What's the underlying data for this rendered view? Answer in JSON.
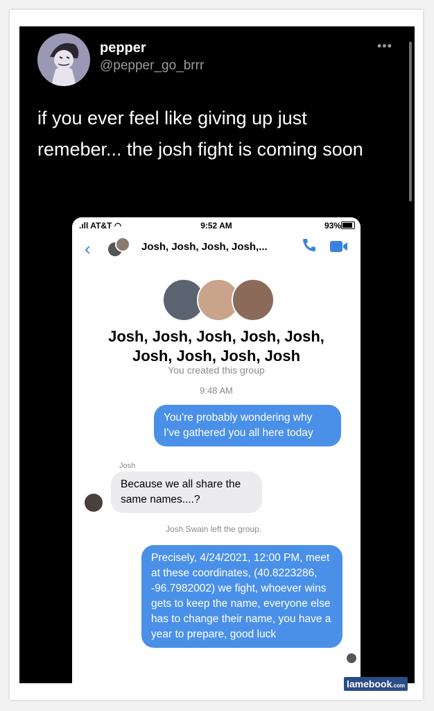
{
  "tweet": {
    "display_name": "pepper",
    "handle": "@pepper_go_brrr",
    "text": "if you ever feel like giving up just remeber... the josh fight is coming soon",
    "more_icon": "ellipsis-icon"
  },
  "screenshot": {
    "status": {
      "carrier": "AT&T",
      "time": "9:52 AM",
      "battery": "93%"
    },
    "header": {
      "title": "Josh, Josh, Josh, Josh,..."
    },
    "group_name": "Josh, Josh, Josh, Josh, Josh, Josh, Josh, Josh, Josh",
    "created_text": "You created this group",
    "timestamp": "9:48 AM",
    "messages": [
      {
        "from": "me",
        "text": "You're probably wondering why I've gathered you all here today"
      },
      {
        "from": "Josh",
        "text": "Because we all share the same names....?"
      },
      {
        "from": "system",
        "text": "Josh Swain left the group."
      },
      {
        "from": "me",
        "text": "Precisely, 4/24/2021, 12:00 PM, meet at these coordinates, (40.8223286, -96.7982002) we fight, whoever wins gets to keep the name, everyone else has to change their name, you have a year to prepare, good luck"
      }
    ]
  },
  "watermark": {
    "main": "lamebook",
    "suffix": ".com"
  },
  "colors": {
    "bubble_blue": "#4a90e8",
    "bubble_gray": "#ececee",
    "accent": "#3b82e0"
  }
}
